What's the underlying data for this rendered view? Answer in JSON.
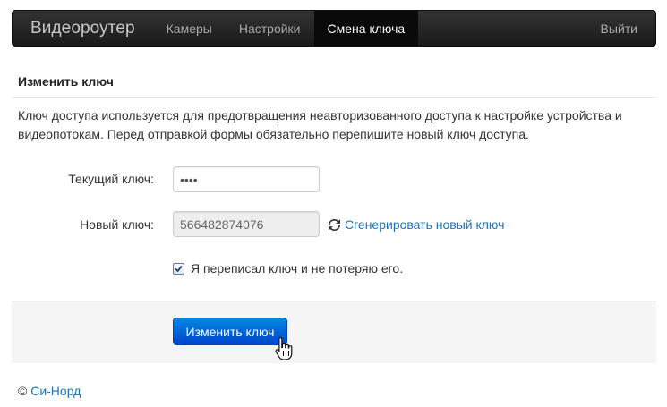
{
  "navbar": {
    "brand": "Видеороутер",
    "items": [
      {
        "label": "Камеры"
      },
      {
        "label": "Настройки"
      },
      {
        "label": "Смена ключа",
        "active": true
      }
    ],
    "logout": "Выйти"
  },
  "panel": {
    "title": "Изменить ключ",
    "description": "Ключ доступа используется для предотвращения неавторизованного доступа к настройке устройства и видеопотокам. Перед отправкой формы обязательно перепишите новый ключ доступа."
  },
  "form": {
    "current_key_label": "Текущий ключ:",
    "current_key_value": "••••",
    "new_key_label": "Новый ключ:",
    "new_key_value": "566482874076",
    "generate_link": "Сгенерировать новый ключ",
    "confirm_label": "Я переписал ключ и не потеряю его.",
    "confirm_checked": true,
    "submit_label": "Изменить ключ"
  },
  "footer": {
    "copyright": "©",
    "company": "Си-Норд"
  },
  "icons": {
    "generate": "refresh-icon",
    "cursor": "hand-pointer-icon"
  },
  "colors": {
    "navbar_bg": "#222222",
    "link": "#1a73b8",
    "primary_button": "#0066d6",
    "actions_bg": "#f5f5f5"
  }
}
